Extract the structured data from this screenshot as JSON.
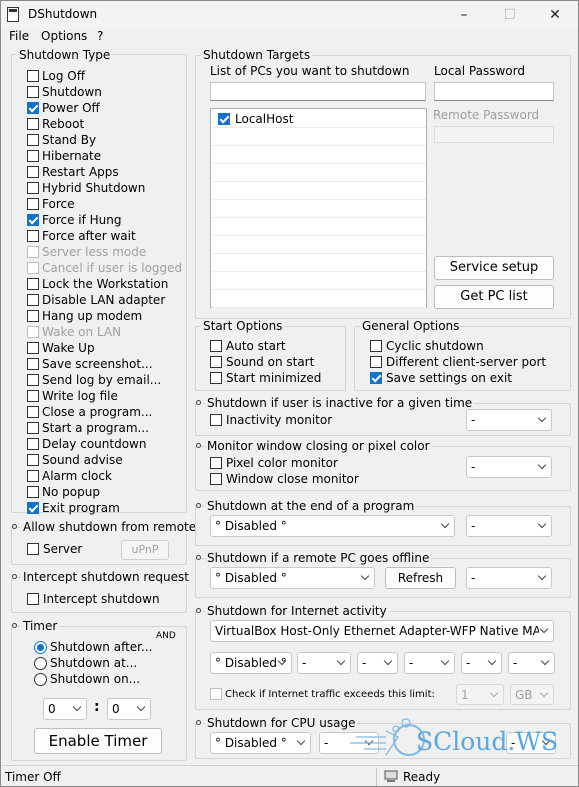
{
  "window": {
    "title": "DShutdown",
    "minimize": "–",
    "maximize": "☐",
    "close": "✕"
  },
  "menu": [
    "File",
    "Options",
    "?"
  ],
  "shutdown_type": {
    "title": "Shutdown Type",
    "items": [
      {
        "label": "Log Off",
        "checked": false,
        "enabled": true
      },
      {
        "label": "Shutdown",
        "checked": false,
        "enabled": true
      },
      {
        "label": "Power Off",
        "checked": true,
        "enabled": true
      },
      {
        "label": "Reboot",
        "checked": false,
        "enabled": true
      },
      {
        "label": "Stand By",
        "checked": false,
        "enabled": true
      },
      {
        "label": "Hibernate",
        "checked": false,
        "enabled": true
      },
      {
        "label": "Restart Apps",
        "checked": false,
        "enabled": true
      },
      {
        "label": "Hybrid Shutdown",
        "checked": false,
        "enabled": true
      },
      {
        "label": "Force",
        "checked": false,
        "enabled": true
      },
      {
        "label": "Force if Hung",
        "checked": true,
        "enabled": true
      },
      {
        "label": "Force after wait",
        "checked": false,
        "enabled": true
      },
      {
        "label": "Server less mode",
        "checked": false,
        "enabled": false
      },
      {
        "label": "Cancel if user is logged",
        "checked": false,
        "enabled": false
      },
      {
        "label": "Lock the Workstation",
        "checked": false,
        "enabled": true
      },
      {
        "label": "Disable LAN adapter",
        "checked": false,
        "enabled": true
      },
      {
        "label": "Hang up modem",
        "checked": false,
        "enabled": true
      },
      {
        "label": "Wake on LAN",
        "checked": false,
        "enabled": false
      },
      {
        "label": "Wake Up",
        "checked": false,
        "enabled": true
      },
      {
        "label": "Save screenshot...",
        "checked": false,
        "enabled": true
      },
      {
        "label": "Send log by email...",
        "checked": false,
        "enabled": true
      },
      {
        "label": "Write log file",
        "checked": false,
        "enabled": true
      },
      {
        "label": "Close a program...",
        "checked": false,
        "enabled": true
      },
      {
        "label": "Start a program...",
        "checked": false,
        "enabled": true
      },
      {
        "label": "Delay countdown",
        "checked": false,
        "enabled": true
      },
      {
        "label": "Sound advise",
        "checked": false,
        "enabled": true
      },
      {
        "label": "Alarm clock",
        "checked": false,
        "enabled": true
      },
      {
        "label": "No popup",
        "checked": false,
        "enabled": true
      },
      {
        "label": "Exit program",
        "checked": true,
        "enabled": true
      }
    ]
  },
  "allow_remote": {
    "title": "Allow shutdown from remote",
    "server_label": "Server",
    "upnp_label": "uPnP"
  },
  "intercept": {
    "title": "Intercept shutdown request",
    "checkbox_label": "Intercept shutdown"
  },
  "timer": {
    "title": "Timer",
    "and_label": "AND",
    "options": [
      {
        "label": "Shutdown after...",
        "selected": true
      },
      {
        "label": "Shutdown at...",
        "selected": false
      },
      {
        "label": "Shutdown on...",
        "selected": false
      }
    ],
    "hours": "0",
    "separator": ":",
    "minutes": "0",
    "enable_button": "Enable Timer"
  },
  "targets": {
    "title": "Shutdown Targets",
    "list_label": "List of PCs you want to shutdown",
    "local_password_label": "Local Password",
    "remote_password_label": "Remote Password",
    "pcs": [
      {
        "name": "LocalHost",
        "checked": true
      }
    ],
    "service_setup": "Service setup",
    "get_pc_list": "Get PC list"
  },
  "start_options": {
    "title": "Start Options",
    "items": [
      {
        "label": "Auto start",
        "checked": false
      },
      {
        "label": "Sound on start",
        "checked": false
      },
      {
        "label": "Start minimized",
        "checked": false
      }
    ]
  },
  "general_options": {
    "title": "General Options",
    "items": [
      {
        "label": "Cyclic shutdown",
        "checked": false
      },
      {
        "label": "Different client-server port",
        "checked": false
      },
      {
        "label": "Save settings on exit",
        "checked": true
      }
    ]
  },
  "inactive": {
    "title": "Shutdown if user is inactive for a given time",
    "checkbox_label": "Inactivity monitor",
    "select": "-"
  },
  "monitor_window": {
    "title": "Monitor window closing or pixel color",
    "pixel_label": "Pixel color monitor",
    "window_label": "Window close monitor",
    "select": "-"
  },
  "end_program": {
    "title": "Shutdown at the end of a program",
    "select": "° Disabled °",
    "select2": "-"
  },
  "remote_offline": {
    "title": "Shutdown if a remote PC goes offline",
    "select": "° Disabled °",
    "refresh": "Refresh",
    "select2": "-"
  },
  "internet": {
    "title": "Shutdown for Internet activity",
    "adapter": "VirtualBox Host-Only Ethernet Adapter-WFP Native MAC Layer",
    "mode": "° Disabled °",
    "dashes": [
      "-",
      "-",
      "-",
      "-",
      "-",
      "-"
    ],
    "check_label": "Check if Internet traffic exceeds this limit:",
    "limit": "1",
    "unit": "GB"
  },
  "cpu": {
    "title": "Shutdown for CPU usage",
    "mode": "° Disabled °",
    "dashes": [
      "-",
      "-",
      "-"
    ]
  },
  "watermark": "SCloud.WS",
  "status": {
    "left": "Timer Off",
    "right": "Ready"
  }
}
